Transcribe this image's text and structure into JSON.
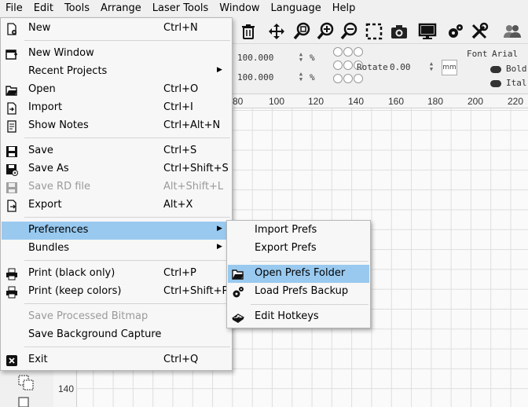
{
  "menubar": [
    "File",
    "Edit",
    "Tools",
    "Arrange",
    "Laser Tools",
    "Window",
    "Language",
    "Help"
  ],
  "toolbar_icons": [
    "trash-icon",
    "move-icon",
    "zoom-fit-icon",
    "zoom-in-icon",
    "zoom-out-icon",
    "select-frame-icon",
    "camera-icon",
    "monitor-icon",
    "gears-icon",
    "tools-icon",
    "users-icon"
  ],
  "props": {
    "width_value": "100.000",
    "height_value": "100.000",
    "percent": "%",
    "rotate_label": "Rotate",
    "rotate_value": "0.00",
    "unit": "mm",
    "font_label": "Font",
    "font_value": "Arial",
    "bold_label": "Bold",
    "italic_label": "Ital"
  },
  "ruler_top": [
    "80",
    "100",
    "120",
    "140",
    "160",
    "180",
    "200",
    "220"
  ],
  "ruler_left": [
    "140"
  ],
  "file_menu": {
    "new": {
      "label": "New",
      "shortcut": "Ctrl+N"
    },
    "new_window": {
      "label": "New Window"
    },
    "recent_projects": {
      "label": "Recent Projects"
    },
    "open": {
      "label": "Open",
      "shortcut": "Ctrl+O"
    },
    "import": {
      "label": "Import",
      "shortcut": "Ctrl+I"
    },
    "show_notes": {
      "label": "Show Notes",
      "shortcut": "Ctrl+Alt+N"
    },
    "save": {
      "label": "Save",
      "shortcut": "Ctrl+S"
    },
    "save_as": {
      "label": "Save As",
      "shortcut": "Ctrl+Shift+S"
    },
    "save_rd": {
      "label": "Save RD file",
      "shortcut": "Alt+Shift+L"
    },
    "export": {
      "label": "Export",
      "shortcut": "Alt+X"
    },
    "preferences": {
      "label": "Preferences"
    },
    "bundles": {
      "label": "Bundles"
    },
    "print_black": {
      "label": "Print (black only)",
      "shortcut": "Ctrl+P"
    },
    "print_colors": {
      "label": "Print (keep colors)",
      "shortcut": "Ctrl+Shift+P"
    },
    "save_bitmap": {
      "label": "Save Processed Bitmap"
    },
    "save_background": {
      "label": "Save Background Capture"
    },
    "exit": {
      "label": "Exit",
      "shortcut": "Ctrl+Q"
    }
  },
  "prefs_menu": {
    "import_prefs": "Import Prefs",
    "export_prefs": "Export Prefs",
    "open_prefs_folder": "Open Prefs Folder",
    "load_prefs_backup": "Load Prefs Backup",
    "edit_hotkeys": "Edit Hotkeys"
  },
  "colors": {
    "highlight": "#99c9ef",
    "disabled_text": "#9a9a9a"
  }
}
